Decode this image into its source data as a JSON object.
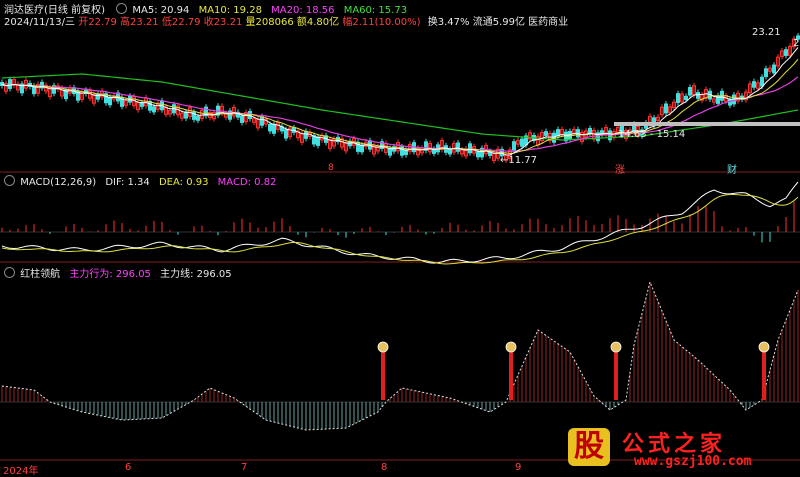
{
  "header": {
    "stock_title": "润达医疗(日线 前复权)",
    "ma5": "MA5: 20.94",
    "ma10": "MA10: 19.28",
    "ma20": "MA20: 18.56",
    "ma60": "MA60: 15.73",
    "date": "2024/11/13/三",
    "open": "开22.79",
    "high": "高23.21",
    "low": "低22.79",
    "close": "收23.21",
    "volume": "量208066",
    "amount": "额4.80亿",
    "change": "幅2.11(10.00%)",
    "turnover": "换3.47%",
    "float": "流通5.99亿",
    "industry": "医药商业"
  },
  "price_panel": {
    "high_label": "23.21",
    "low_label": "11.77",
    "range_label": "14.63 - 15.14",
    "edge_label": "22",
    "marker_a": "8",
    "marker_b": "涨",
    "marker_c": "财"
  },
  "macd_panel": {
    "title": "MACD(12,26,9)",
    "dif": "DIF: 1.34",
    "dea": "DEA: 0.93",
    "macd": "MACD: 0.82"
  },
  "indicator_panel": {
    "title": "红柱领航",
    "line1": "主力行为: 296.05",
    "line2": "主力线: 296.05"
  },
  "time_axis": {
    "labels": [
      "2024年",
      "6",
      "7",
      "8",
      "9"
    ]
  },
  "watermark": {
    "char": "股",
    "text": "公式之家",
    "url": "www.gszj100.com"
  },
  "colors": {
    "up": "#ff3030",
    "down": "#40e0e0",
    "ma5": "#ffffff",
    "ma10": "#ffff40",
    "ma20": "#ff40ff",
    "ma60": "#20c020",
    "bg": "#000000"
  }
}
